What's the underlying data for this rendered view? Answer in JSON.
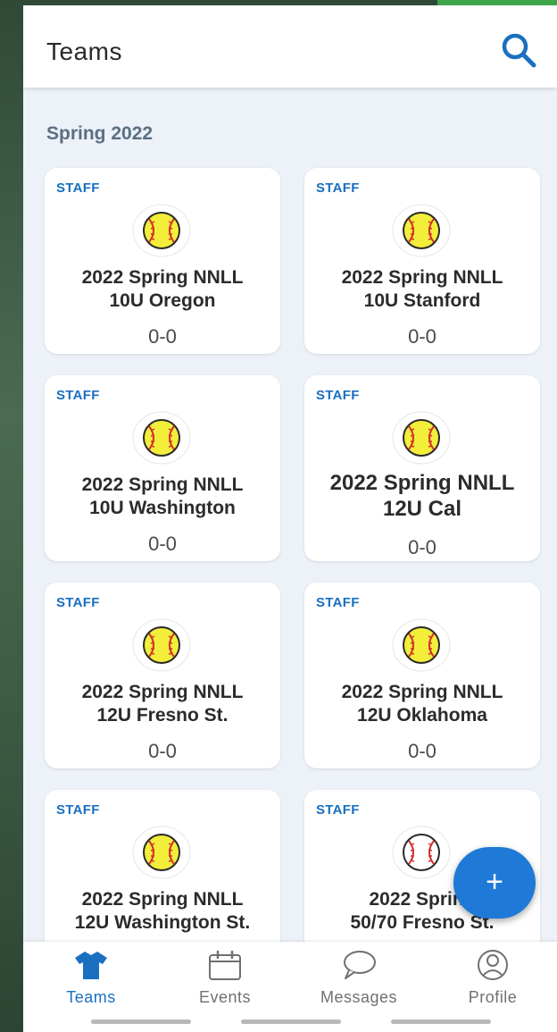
{
  "header": {
    "title": "Teams"
  },
  "section": {
    "title": "Spring 2022"
  },
  "teams": [
    {
      "role": "STAFF",
      "name_line1": "2022 Spring NNLL",
      "name_line2": "10U Oregon",
      "record": "0-0",
      "sport_icon": "softball-icon"
    },
    {
      "role": "STAFF",
      "name_line1": "2022 Spring NNLL",
      "name_line2": "10U Stanford",
      "record": "0-0",
      "sport_icon": "softball-icon"
    },
    {
      "role": "STAFF",
      "name_line1": "2022 Spring NNLL",
      "name_line2": "10U Washington",
      "record": "0-0",
      "sport_icon": "softball-icon"
    },
    {
      "role": "STAFF",
      "name_line1": "2022 Spring NNLL",
      "name_line2": "12U Cal",
      "record": "0-0",
      "sport_icon": "softball-icon"
    },
    {
      "role": "STAFF",
      "name_line1": "2022 Spring NNLL",
      "name_line2": "12U Fresno St.",
      "record": "0-0",
      "sport_icon": "softball-icon"
    },
    {
      "role": "STAFF",
      "name_line1": "2022 Spring NNLL",
      "name_line2": "12U Oklahoma",
      "record": "0-0",
      "sport_icon": "softball-icon"
    },
    {
      "role": "STAFF",
      "name_line1": "2022 Spring NNLL",
      "name_line2": "12U Washington St.",
      "record": "",
      "sport_icon": "softball-icon"
    },
    {
      "role": "STAFF",
      "name_line1": "2022 Spring",
      "name_line2": "50/70 Fresno St.",
      "record": "",
      "sport_icon": "baseball-icon"
    }
  ],
  "fab": {
    "label": "+"
  },
  "nav": {
    "items": [
      {
        "label": "Teams",
        "icon": "jersey-icon",
        "active": true
      },
      {
        "label": "Events",
        "icon": "calendar-icon",
        "active": false
      },
      {
        "label": "Messages",
        "icon": "chat-bubble-icon",
        "active": false
      },
      {
        "label": "Profile",
        "icon": "person-icon",
        "active": false
      }
    ]
  },
  "colors": {
    "accent": "#1a6fc1",
    "background": "#edf1f8",
    "softball": "#f2ee3a",
    "stitch": "#d32f2f"
  }
}
